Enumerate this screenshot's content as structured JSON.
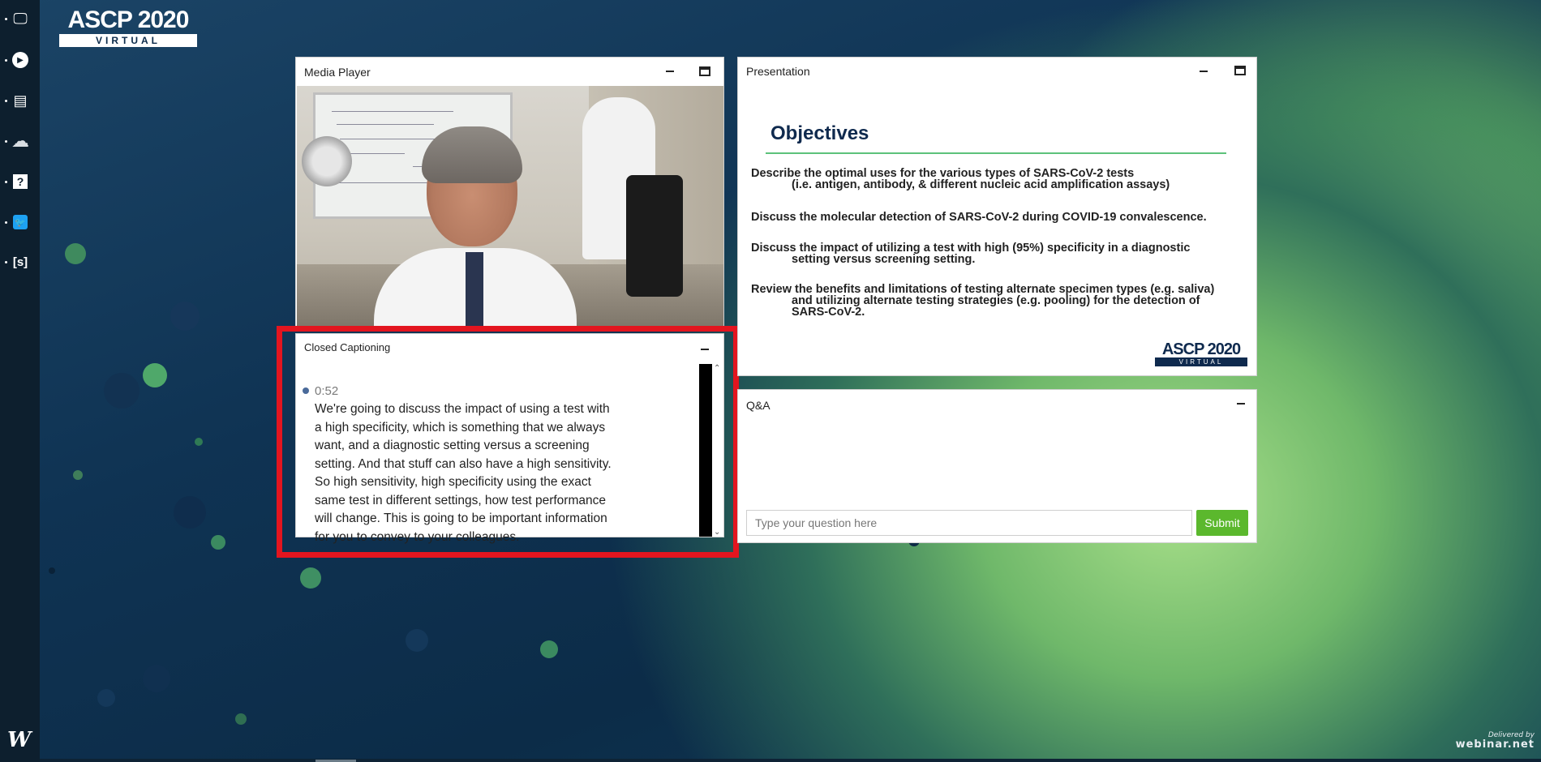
{
  "brand": {
    "logo_top": "ASCP 2020",
    "logo_bottom": "VIRTUAL"
  },
  "sidebar": {
    "items": [
      {
        "icon": "presentation-icon",
        "glyph": "🖵"
      },
      {
        "icon": "play-icon",
        "glyph": "▶"
      },
      {
        "icon": "contact-card-icon",
        "glyph": "▤"
      },
      {
        "icon": "cloud-icon",
        "glyph": "☁"
      },
      {
        "icon": "help-icon",
        "glyph": "?"
      },
      {
        "icon": "twitter-icon",
        "glyph": "🐦"
      },
      {
        "icon": "slides-icon",
        "glyph": "[s]"
      }
    ],
    "logo_glyph": "W"
  },
  "media_player": {
    "title": "Media Player"
  },
  "closed_captioning": {
    "title": "Closed Captioning",
    "entries": [
      {
        "time": "0:52",
        "text": "We're going to discuss the impact of using a test with a high specificity, which is something that we always want, and a diagnostic setting versus a screening setting. And that stuff can also have a high sensitivity. So high sensitivity, high specificity using the exact same test in different settings, how test performance will change. This is going to be important information for you to convey to your colleagues."
      }
    ]
  },
  "presentation": {
    "title": "Presentation",
    "slide": {
      "heading": "Objectives",
      "objectives": [
        {
          "line1": "Describe the optimal uses for the various types of SARS-CoV-2 tests",
          "line2": "(i.e. antigen, antibody, & different nucleic acid amplification assays)"
        },
        {
          "line1": "Discuss the molecular detection of SARS-CoV-2 during COVID-19 convalescence.",
          "line2": ""
        },
        {
          "line1": "Discuss the impact of utilizing a test with high (95%) specificity in a diagnostic",
          "line2": "setting versus screening setting."
        },
        {
          "line1": "Review the benefits and limitations of testing alternate specimen types (e.g. saliva)",
          "line2": "and utilizing alternate testing strategies (e.g. pooling) for the detection of SARS-CoV-2."
        }
      ],
      "logo_top": "ASCP 2020",
      "logo_bottom": "VIRTUAL"
    }
  },
  "qa": {
    "title": "Q&A",
    "input_placeholder": "Type your question here",
    "submit_label": "Submit"
  },
  "footer": {
    "delivered_by": "Delivered by",
    "brand": "webinar.net"
  }
}
